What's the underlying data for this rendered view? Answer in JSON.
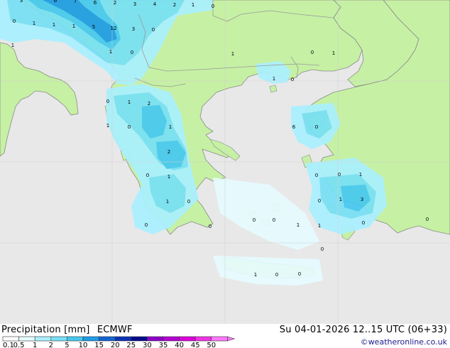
{
  "map": {
    "title": "Precipitation [mm]",
    "model": "ECMWF",
    "valid_time": "Su 04-01-2026 12..15 UTC (06+33)",
    "credit": "©weatheronline.co.uk",
    "colors": {
      "sea": "#e8e8e8",
      "land": "#c6f0a4",
      "border": "#9a9a9a",
      "coast": "#8a8a8a"
    },
    "legend": {
      "labels": [
        "0.1",
        "0.5",
        "1",
        "2",
        "5",
        "10",
        "15",
        "20",
        "25",
        "30",
        "35",
        "40",
        "45",
        "50"
      ],
      "colors": [
        "#ffffff",
        "#e6fbff",
        "#aaf0ff",
        "#78e0f5",
        "#46c8f0",
        "#1e9ce6",
        "#1464d2",
        "#0a32b4",
        "#050a8c",
        "#8c00c8",
        "#b400d2",
        "#dc00dc",
        "#f032e6",
        "#ff78ff"
      ]
    },
    "station_values": [
      "3",
      "6",
      "7",
      "6",
      "2",
      "3",
      "4",
      "2",
      "1",
      "0",
      "0",
      "1",
      "1",
      "1",
      "5",
      "12",
      "3",
      "0",
      "1",
      "1",
      "0",
      "1",
      "0",
      "1",
      "1",
      "0",
      "0",
      "1",
      "2",
      "1",
      "0",
      "1",
      "2",
      "6",
      "0",
      "0",
      "1",
      "0",
      "0",
      "1",
      "1",
      "0",
      "0",
      "1",
      "0",
      "0",
      "1",
      "1",
      "3",
      "0",
      "0",
      "0",
      "1",
      "0",
      "0",
      "0",
      "0"
    ]
  }
}
